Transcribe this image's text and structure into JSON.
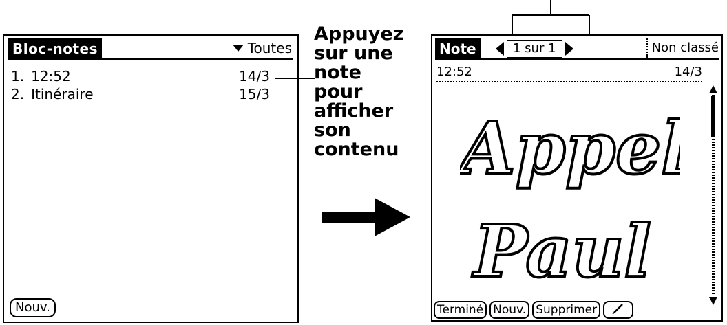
{
  "left_screen": {
    "title": "Bloc-notes",
    "category": "Toutes",
    "memos": [
      {
        "num": "1.",
        "title": "12:52",
        "date": "14/3"
      },
      {
        "num": "2.",
        "title": "Itinéraire",
        "date": "15/3"
      }
    ],
    "new_button": "Nouv."
  },
  "annotation": {
    "lines": [
      "Appuyez",
      "sur une",
      "note",
      "pour",
      "afficher",
      "son",
      "contenu"
    ]
  },
  "right_screen": {
    "title": "Note",
    "pager": "1 sur 1",
    "category": "Non classé",
    "note_title": "12:52",
    "note_date": "14/3",
    "ink_text": [
      "Appeler",
      "Paul"
    ],
    "buttons": {
      "done": "Terminé",
      "new": "Nouv.",
      "delete": "Supprimer"
    },
    "pen_icon": "pencil-icon"
  }
}
